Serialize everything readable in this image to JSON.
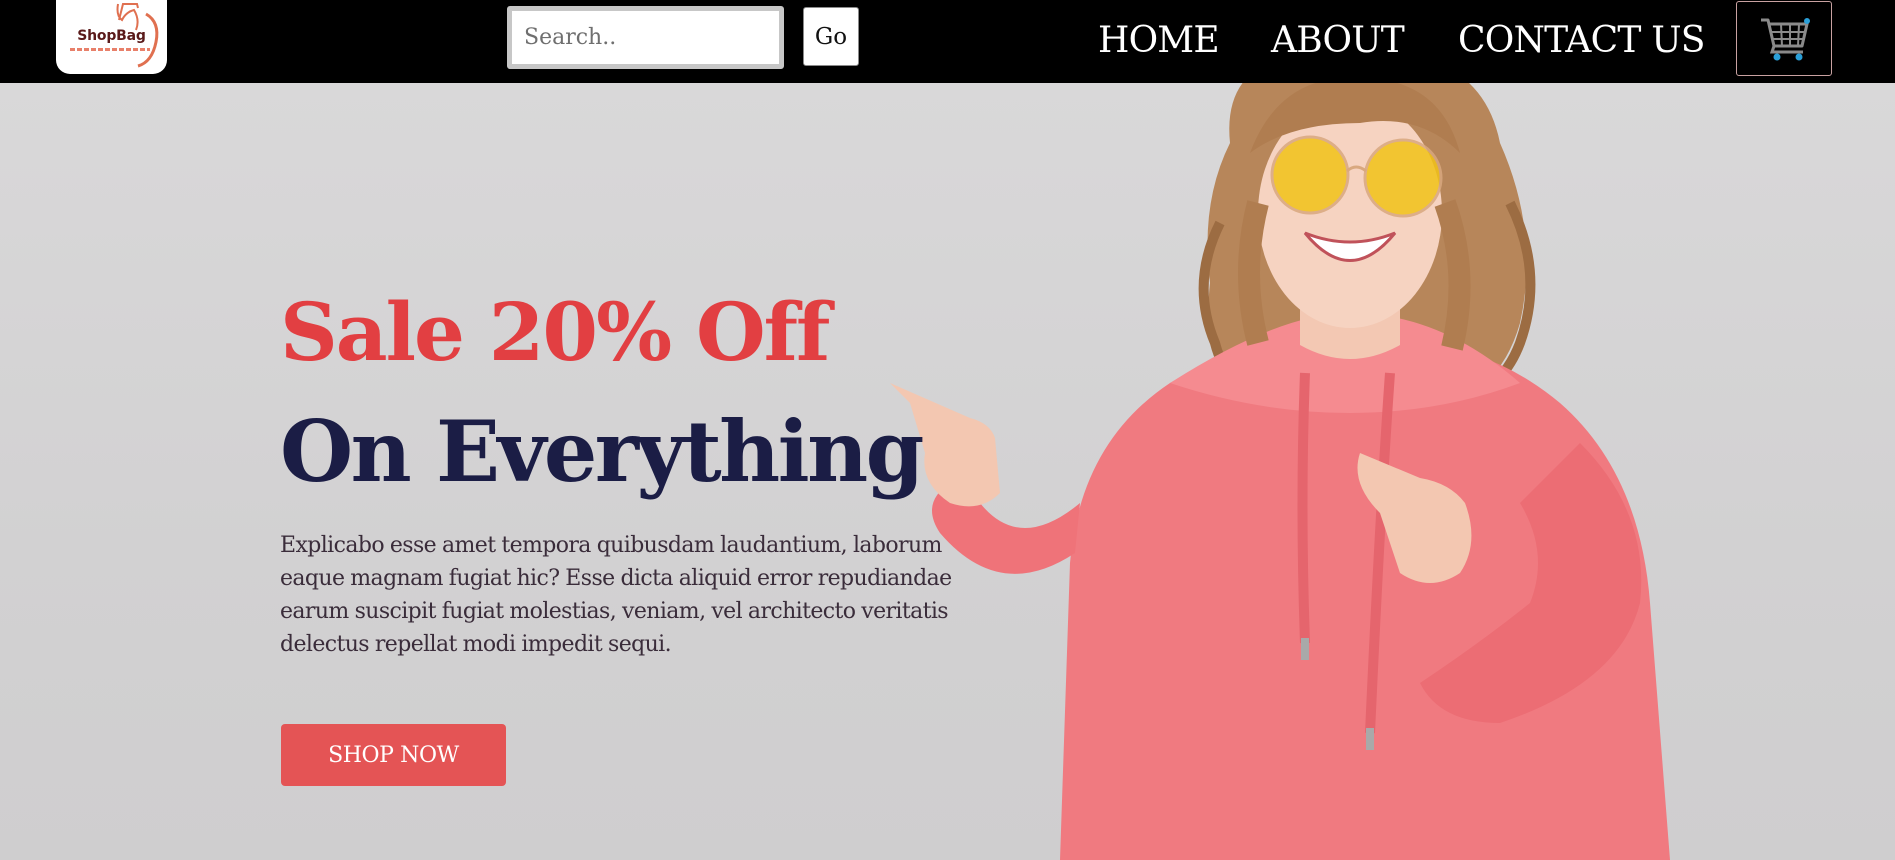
{
  "header": {
    "logo_text": "ShopBag",
    "search": {
      "placeholder": "Search..",
      "value": ""
    },
    "go_label": "Go",
    "nav": {
      "home": "HOME",
      "about": "ABOUT",
      "contact": "CONTACT US"
    },
    "cart_icon": "shopping-cart-icon"
  },
  "hero": {
    "headline_sale": "Sale 20% Off",
    "headline_everything": "On Everything",
    "description": "Explicabo esse amet tempora quibusdam laudantium, laborum eaque magnam fugiat hic? Esse dicta aliquid error repudiandae earum suscipit fugiat molestias, veniam, vel architecto veritatis delectus repellat modi impedit sequi.",
    "cta_label": "SHOP NOW",
    "image": "model-in-pink-hoodie-pointing"
  },
  "colors": {
    "header_bg": "#000000",
    "sale_red": "#e23f42",
    "headline_navy": "#1b1d45",
    "button_red": "#e45455",
    "hoodie_pink": "#f07a80",
    "hero_bg": "#d7d6d7"
  }
}
